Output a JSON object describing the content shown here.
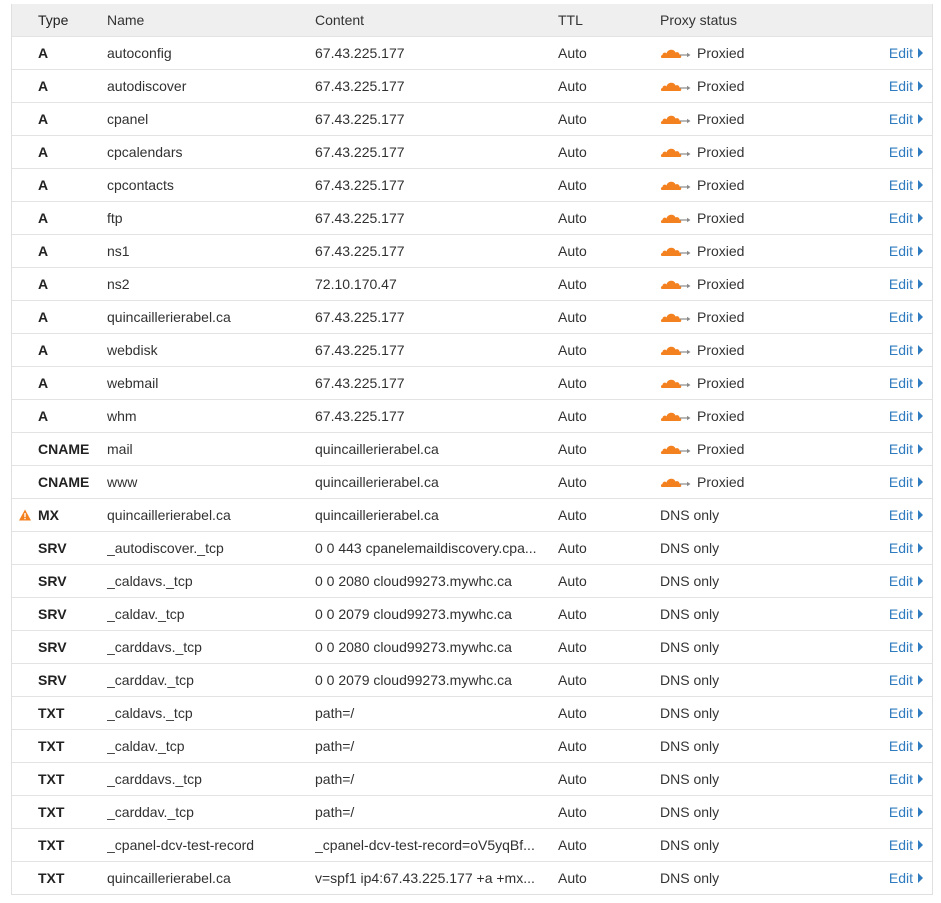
{
  "columns": {
    "type": "Type",
    "name": "Name",
    "content": "Content",
    "ttl": "TTL",
    "proxy": "Proxy status"
  },
  "edit_label": "Edit",
  "colors": {
    "cloud_orange": "#f48120",
    "link_blue": "#2f7bbf",
    "warning_orange": "#f48120"
  },
  "rows": [
    {
      "type": "A",
      "name": "autoconfig",
      "content": "67.43.225.177",
      "ttl": "Auto",
      "proxy": "Proxied",
      "proxied": true,
      "warning": false
    },
    {
      "type": "A",
      "name": "autodiscover",
      "content": "67.43.225.177",
      "ttl": "Auto",
      "proxy": "Proxied",
      "proxied": true,
      "warning": false
    },
    {
      "type": "A",
      "name": "cpanel",
      "content": "67.43.225.177",
      "ttl": "Auto",
      "proxy": "Proxied",
      "proxied": true,
      "warning": false
    },
    {
      "type": "A",
      "name": "cpcalendars",
      "content": "67.43.225.177",
      "ttl": "Auto",
      "proxy": "Proxied",
      "proxied": true,
      "warning": false
    },
    {
      "type": "A",
      "name": "cpcontacts",
      "content": "67.43.225.177",
      "ttl": "Auto",
      "proxy": "Proxied",
      "proxied": true,
      "warning": false
    },
    {
      "type": "A",
      "name": "ftp",
      "content": "67.43.225.177",
      "ttl": "Auto",
      "proxy": "Proxied",
      "proxied": true,
      "warning": false
    },
    {
      "type": "A",
      "name": "ns1",
      "content": "67.43.225.177",
      "ttl": "Auto",
      "proxy": "Proxied",
      "proxied": true,
      "warning": false
    },
    {
      "type": "A",
      "name": "ns2",
      "content": "72.10.170.47",
      "ttl": "Auto",
      "proxy": "Proxied",
      "proxied": true,
      "warning": false
    },
    {
      "type": "A",
      "name": "quincaillerierabel.ca",
      "content": "67.43.225.177",
      "ttl": "Auto",
      "proxy": "Proxied",
      "proxied": true,
      "warning": false
    },
    {
      "type": "A",
      "name": "webdisk",
      "content": "67.43.225.177",
      "ttl": "Auto",
      "proxy": "Proxied",
      "proxied": true,
      "warning": false
    },
    {
      "type": "A",
      "name": "webmail",
      "content": "67.43.225.177",
      "ttl": "Auto",
      "proxy": "Proxied",
      "proxied": true,
      "warning": false
    },
    {
      "type": "A",
      "name": "whm",
      "content": "67.43.225.177",
      "ttl": "Auto",
      "proxy": "Proxied",
      "proxied": true,
      "warning": false
    },
    {
      "type": "CNAME",
      "name": "mail",
      "content": "quincaillerierabel.ca",
      "ttl": "Auto",
      "proxy": "Proxied",
      "proxied": true,
      "warning": false
    },
    {
      "type": "CNAME",
      "name": "www",
      "content": "quincaillerierabel.ca",
      "ttl": "Auto",
      "proxy": "Proxied",
      "proxied": true,
      "warning": false
    },
    {
      "type": "MX",
      "name": "quincaillerierabel.ca",
      "content": "quincaillerierabel.ca",
      "ttl": "Auto",
      "proxy": "DNS only",
      "proxied": false,
      "warning": true
    },
    {
      "type": "SRV",
      "name": "_autodiscover._tcp",
      "content": "0 0 443 cpanelemaildiscovery.cpa...",
      "ttl": "Auto",
      "proxy": "DNS only",
      "proxied": false,
      "warning": false
    },
    {
      "type": "SRV",
      "name": "_caldavs._tcp",
      "content": "0 0 2080 cloud99273.mywhc.ca",
      "ttl": "Auto",
      "proxy": "DNS only",
      "proxied": false,
      "warning": false
    },
    {
      "type": "SRV",
      "name": "_caldav._tcp",
      "content": "0 0 2079 cloud99273.mywhc.ca",
      "ttl": "Auto",
      "proxy": "DNS only",
      "proxied": false,
      "warning": false
    },
    {
      "type": "SRV",
      "name": "_carddavs._tcp",
      "content": "0 0 2080 cloud99273.mywhc.ca",
      "ttl": "Auto",
      "proxy": "DNS only",
      "proxied": false,
      "warning": false
    },
    {
      "type": "SRV",
      "name": "_carddav._tcp",
      "content": "0 0 2079 cloud99273.mywhc.ca",
      "ttl": "Auto",
      "proxy": "DNS only",
      "proxied": false,
      "warning": false
    },
    {
      "type": "TXT",
      "name": "_caldavs._tcp",
      "content": "path=/",
      "ttl": "Auto",
      "proxy": "DNS only",
      "proxied": false,
      "warning": false
    },
    {
      "type": "TXT",
      "name": "_caldav._tcp",
      "content": "path=/",
      "ttl": "Auto",
      "proxy": "DNS only",
      "proxied": false,
      "warning": false
    },
    {
      "type": "TXT",
      "name": "_carddavs._tcp",
      "content": "path=/",
      "ttl": "Auto",
      "proxy": "DNS only",
      "proxied": false,
      "warning": false
    },
    {
      "type": "TXT",
      "name": "_carddav._tcp",
      "content": "path=/",
      "ttl": "Auto",
      "proxy": "DNS only",
      "proxied": false,
      "warning": false
    },
    {
      "type": "TXT",
      "name": "_cpanel-dcv-test-record",
      "content": "_cpanel-dcv-test-record=oV5yqBf...",
      "ttl": "Auto",
      "proxy": "DNS only",
      "proxied": false,
      "warning": false
    },
    {
      "type": "TXT",
      "name": "quincaillerierabel.ca",
      "content": "v=spf1 ip4:67.43.225.177 +a +mx...",
      "ttl": "Auto",
      "proxy": "DNS only",
      "proxied": false,
      "warning": false
    }
  ]
}
